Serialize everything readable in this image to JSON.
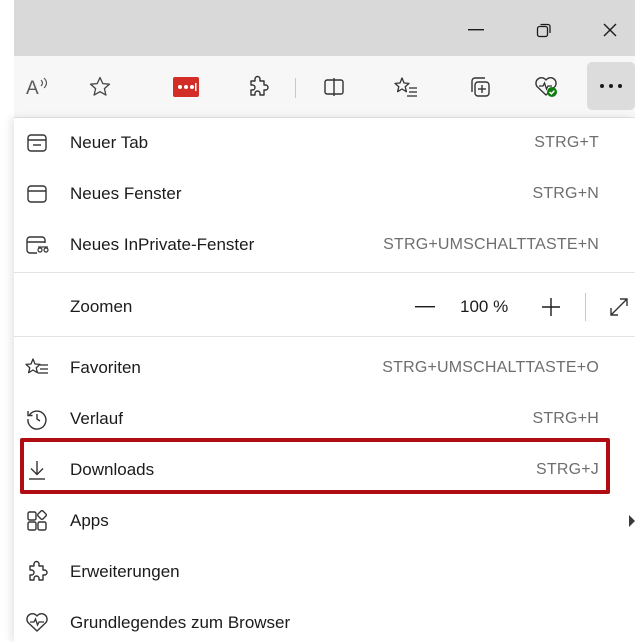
{
  "window": {
    "minimize_glyph": "—",
    "restore_glyph": "❐",
    "close_glyph": "✕"
  },
  "toolbar": {
    "icons": [
      "read-aloud-icon",
      "favorite-star-icon",
      "lastpass-extension-icon",
      "extensions-puzzle-icon",
      "split-screen-icon",
      "favorites-list-icon",
      "collections-icon",
      "browser-essentials-icon",
      "more-menu-icon"
    ],
    "read_aloud_label": "A",
    "more_glyph": "···"
  },
  "menu": {
    "items_top": [
      {
        "icon": "new-tab-icon",
        "label": "Neuer Tab",
        "shortcut": "STRG+T"
      },
      {
        "icon": "new-window-icon",
        "label": "Neues Fenster",
        "shortcut": "STRG+N"
      },
      {
        "icon": "inprivate-window-icon",
        "label": "Neues InPrivate-Fenster",
        "shortcut": "STRG+UMSCHALTTASTE+N"
      }
    ],
    "zoom": {
      "label": "Zoomen",
      "minus": "—",
      "value": "100 %",
      "plus": "+"
    },
    "items_bottom": [
      {
        "icon": "favorites-icon",
        "label": "Favoriten",
        "shortcut": "STRG+UMSCHALTTASTE+O"
      },
      {
        "icon": "history-icon",
        "label": "Verlauf",
        "shortcut": "STRG+H"
      },
      {
        "icon": "download-icon",
        "label": "Downloads",
        "shortcut": "STRG+J"
      },
      {
        "icon": "apps-icon",
        "label": "Apps",
        "shortcut": ""
      },
      {
        "icon": "extensions-icon",
        "label": "Erweiterungen",
        "shortcut": ""
      },
      {
        "icon": "browser-essentials-icon",
        "label": "Grundlegendes zum Browser",
        "shortcut": ""
      }
    ]
  },
  "colors": {
    "highlight": "#b00d12",
    "lastpass": "#d32d27",
    "essentials_badge": "#107c10"
  }
}
